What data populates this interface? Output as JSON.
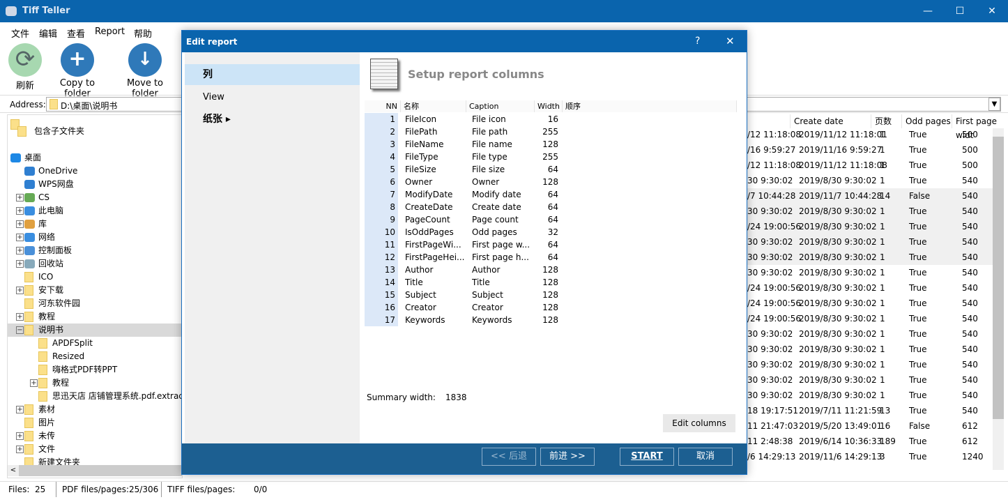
{
  "app": {
    "title": "Tiff Teller",
    "minimize": "—",
    "maximize": "☐",
    "close": "✕"
  },
  "menu": [
    "文件",
    "编辑",
    "查看",
    "Report",
    "帮助"
  ],
  "toolbar": {
    "refresh": "刷新",
    "copy": "Copy to folder",
    "move": "Move to folder"
  },
  "address": {
    "label": "Address:",
    "value": "D:\\桌面\\说明书"
  },
  "tree": {
    "include_subfolders": "包含子文件夹",
    "items": [
      {
        "label": "桌面",
        "level": 0,
        "exp": "",
        "icon": "desktop"
      },
      {
        "label": "OneDrive",
        "level": 1,
        "exp": "",
        "icon": "cloud"
      },
      {
        "label": "WPS网盘",
        "level": 1,
        "exp": "",
        "icon": "cloud"
      },
      {
        "label": "CS",
        "level": 1,
        "exp": "+",
        "icon": "user"
      },
      {
        "label": "此电脑",
        "level": 1,
        "exp": "+",
        "icon": "computer"
      },
      {
        "label": "库",
        "level": 1,
        "exp": "+",
        "icon": "library"
      },
      {
        "label": "网络",
        "level": 1,
        "exp": "+",
        "icon": "network"
      },
      {
        "label": "控制面板",
        "level": 1,
        "exp": "+",
        "icon": "control-panel"
      },
      {
        "label": "回收站",
        "level": 1,
        "exp": "+",
        "icon": "recycle-bin"
      },
      {
        "label": "ICO",
        "level": 1,
        "exp": "",
        "icon": "folder"
      },
      {
        "label": "安下载",
        "level": 1,
        "exp": "+",
        "icon": "folder"
      },
      {
        "label": "河东软件园",
        "level": 1,
        "exp": "",
        "icon": "folder"
      },
      {
        "label": "教程",
        "level": 1,
        "exp": "+",
        "icon": "folder"
      },
      {
        "label": "说明书",
        "level": 1,
        "exp": "−",
        "icon": "folder",
        "selected": true
      },
      {
        "label": "APDFSplit",
        "level": 2,
        "exp": "",
        "icon": "folder"
      },
      {
        "label": "Resized",
        "level": 2,
        "exp": "",
        "icon": "folder"
      },
      {
        "label": "嗨格式PDF转PPT",
        "level": 2,
        "exp": "",
        "icon": "folder"
      },
      {
        "label": "教程",
        "level": 2,
        "exp": "+",
        "icon": "folder"
      },
      {
        "label": "思迅天店 店铺管理系统.pdf.extracte",
        "level": 2,
        "exp": "",
        "icon": "folder"
      },
      {
        "label": "素材",
        "level": 1,
        "exp": "+",
        "icon": "folder"
      },
      {
        "label": "图片",
        "level": 1,
        "exp": "",
        "icon": "folder"
      },
      {
        "label": "未传",
        "level": 1,
        "exp": "+",
        "icon": "folder"
      },
      {
        "label": "文件",
        "level": 1,
        "exp": "+",
        "icon": "folder"
      },
      {
        "label": "新建文件夹",
        "level": 1,
        "exp": "",
        "icon": "folder"
      }
    ]
  },
  "filelist": {
    "headers": [
      "",
      "Create date",
      "页数",
      "Odd pages",
      "First page widt"
    ],
    "rows": [
      [
        "/12 11:18:08",
        "2019/11/12 11:18:01",
        "1",
        "True",
        "500"
      ],
      [
        "/16 9:59:27",
        "2019/11/16 9:59:27",
        "1",
        "True",
        "500"
      ],
      [
        "/12 11:18:08",
        "2019/11/12 11:18:08",
        "1",
        "True",
        "500"
      ],
      [
        "30 9:30:02",
        "2019/8/30 9:30:02",
        "1",
        "True",
        "540"
      ],
      [
        "/7 10:44:28",
        "2019/11/7 10:44:28",
        "14",
        "False",
        "540"
      ],
      [
        "30 9:30:02",
        "2019/8/30 9:30:02",
        "1",
        "True",
        "540"
      ],
      [
        "/24 19:00:56",
        "2019/8/30 9:30:02",
        "1",
        "True",
        "540"
      ],
      [
        "30 9:30:02",
        "2019/8/30 9:30:02",
        "1",
        "True",
        "540"
      ],
      [
        "30 9:30:02",
        "2019/8/30 9:30:02",
        "1",
        "True",
        "540"
      ],
      [
        "30 9:30:02",
        "2019/8/30 9:30:02",
        "1",
        "True",
        "540"
      ],
      [
        "/24 19:00:56",
        "2019/8/30 9:30:02",
        "1",
        "True",
        "540"
      ],
      [
        "/24 19:00:56",
        "2019/8/30 9:30:02",
        "1",
        "True",
        "540"
      ],
      [
        "/24 19:00:56",
        "2019/8/30 9:30:02",
        "1",
        "True",
        "540"
      ],
      [
        "30 9:30:02",
        "2019/8/30 9:30:02",
        "1",
        "True",
        "540"
      ],
      [
        "30 9:30:02",
        "2019/8/30 9:30:02",
        "1",
        "True",
        "540"
      ],
      [
        "30 9:30:02",
        "2019/8/30 9:30:02",
        "1",
        "True",
        "540"
      ],
      [
        "30 9:30:02",
        "2019/8/30 9:30:02",
        "1",
        "True",
        "540"
      ],
      [
        "30 9:30:02",
        "2019/8/30 9:30:02",
        "1",
        "True",
        "540"
      ],
      [
        "18 19:17:51",
        "2019/7/11 11:21:59",
        "13",
        "True",
        "540"
      ],
      [
        "11 21:47:03",
        "2019/5/20 13:49:01",
        "16",
        "False",
        "612"
      ],
      [
        "11 2:48:38",
        "2019/6/14 10:36:33",
        "189",
        "True",
        "612"
      ],
      [
        "/6 14:29:13",
        "2019/11/6 14:29:13",
        "3",
        "True",
        "1240"
      ]
    ]
  },
  "status": {
    "files_label": "Files:",
    "files": "25",
    "pdf_label": "PDF files/pages:",
    "pdf": "25/306",
    "tiff_label": "TIFF files/pages:",
    "tiff": "0/0"
  },
  "dialog": {
    "title": "Edit report",
    "help": "?",
    "close": "✕",
    "nav": [
      "列",
      "View",
      "纸张 ▸"
    ],
    "heading": "Setup report columns",
    "columns_header": [
      "NN",
      "名称",
      "Caption",
      "Width",
      "顺序"
    ],
    "columns": [
      [
        "1",
        "FileIcon",
        "File icon",
        "16"
      ],
      [
        "2",
        "FilePath",
        "File path",
        "255"
      ],
      [
        "3",
        "FileName",
        "File name",
        "128"
      ],
      [
        "4",
        "FileType",
        "File type",
        "255"
      ],
      [
        "5",
        "FileSize",
        "File size",
        "64"
      ],
      [
        "6",
        "Owner",
        "Owner",
        "128"
      ],
      [
        "7",
        "ModifyDate",
        "Modify date",
        "64"
      ],
      [
        "8",
        "CreateDate",
        "Create date",
        "64"
      ],
      [
        "9",
        "PageCount",
        "Page count",
        "64"
      ],
      [
        "10",
        "IsOddPages",
        "Odd pages",
        "32"
      ],
      [
        "11",
        "FirstPageWi...",
        "First page w...",
        "64"
      ],
      [
        "12",
        "FirstPageHei...",
        "First page h...",
        "64"
      ],
      [
        "13",
        "Author",
        "Author",
        "128"
      ],
      [
        "14",
        "Title",
        "Title",
        "128"
      ],
      [
        "15",
        "Subject",
        "Subject",
        "128"
      ],
      [
        "16",
        "Creator",
        "Creator",
        "128"
      ],
      [
        "17",
        "Keywords",
        "Keywords",
        "128"
      ]
    ],
    "summary_label": "Summary width:",
    "summary_value": "1838",
    "edit_columns": "Edit columns",
    "back": "<< 后退",
    "next": "前进 >>",
    "start": "START",
    "cancel": "取消"
  }
}
